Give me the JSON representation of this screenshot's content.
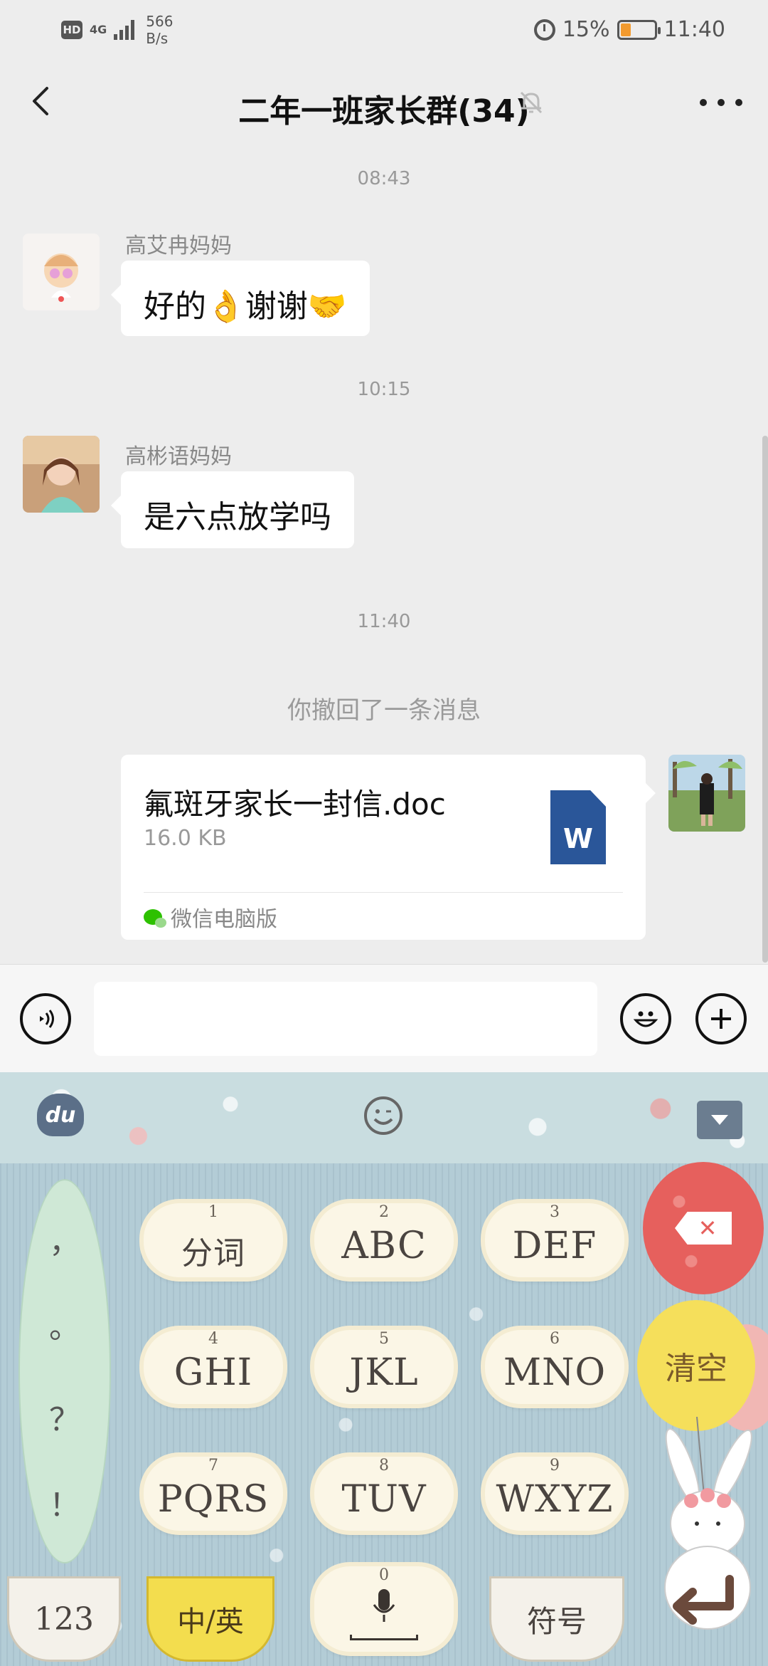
{
  "status": {
    "hd": "HD",
    "network": "4G",
    "speed_value": "566",
    "speed_unit": "B/s",
    "battery": "15%",
    "battery_level": 0.15,
    "time": "11:40"
  },
  "header": {
    "title": "二年一班家长群(34)",
    "muted": true
  },
  "messages": [
    {
      "time": "08:43",
      "sender": "高艾冉妈妈",
      "text": "好的👌谢谢🤝"
    },
    {
      "time": "10:15",
      "sender": "高彬语妈妈",
      "text": "是六点放学吗"
    }
  ],
  "time3": "11:40",
  "recall_notice": "你撤回了一条消息",
  "file": {
    "name": "氟斑牙家长一封信.doc",
    "size": "16.0 KB",
    "icon_letter": "W",
    "source": "微信电脑版"
  },
  "input": {
    "value": ""
  },
  "keyboard": {
    "logo": "du",
    "punctuation": [
      "，",
      "。",
      "？",
      "！"
    ],
    "keys": [
      {
        "num": "1",
        "label": "分词"
      },
      {
        "num": "2",
        "label": "ABC"
      },
      {
        "num": "3",
        "label": "DEF"
      },
      {
        "num": "4",
        "label": "GHI"
      },
      {
        "num": "5",
        "label": "JKL"
      },
      {
        "num": "6",
        "label": "MNO"
      },
      {
        "num": "7",
        "label": "PQRS"
      },
      {
        "num": "8",
        "label": "TUV"
      },
      {
        "num": "9",
        "label": "WXYZ"
      }
    ],
    "clear_label": "清空",
    "num_label": "123",
    "lang_label": "中/英",
    "space_num": "0",
    "symbol_label": "符号"
  },
  "colors": {
    "bg": "#ededed",
    "word_blue": "#2a5699",
    "wechat_green": "#2dc100",
    "balloon_red": "#e6605d",
    "balloon_yellow": "#f5df5b"
  }
}
